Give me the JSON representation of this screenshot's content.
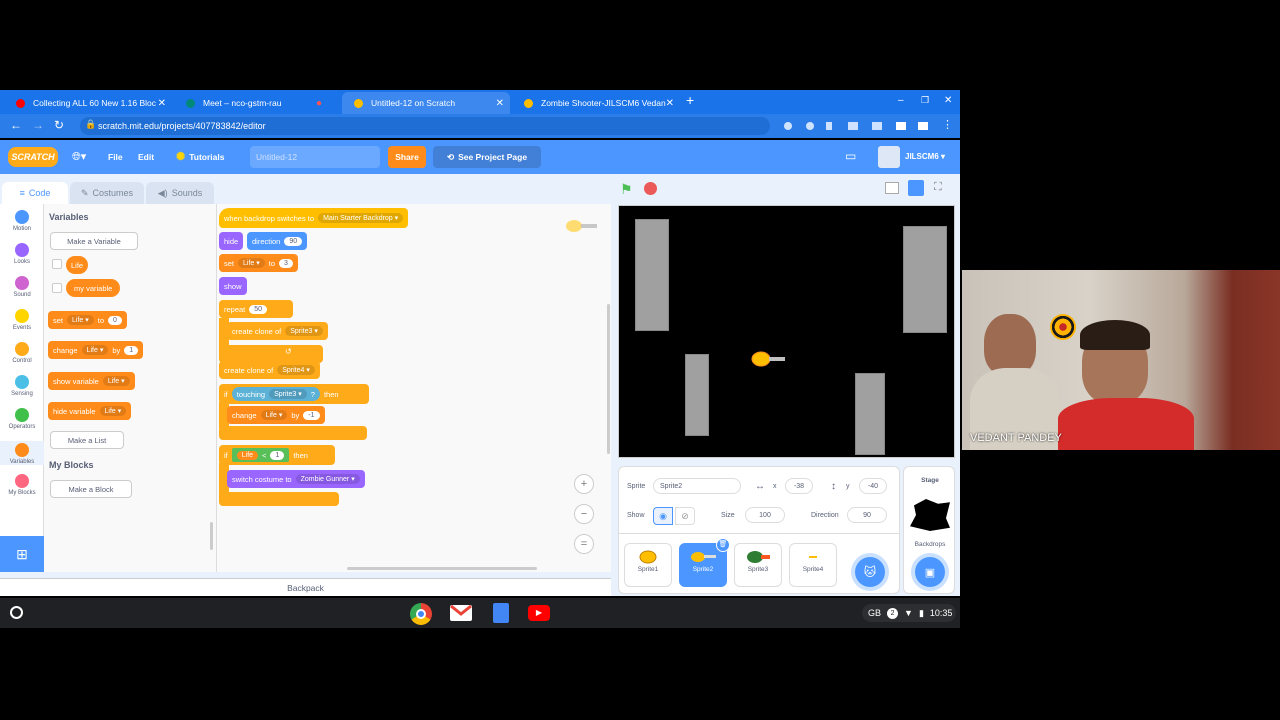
{
  "tabs": [
    {
      "title": "Collecting ALL 60 New 1.16 Bloc",
      "fav_color": "#ff0000"
    },
    {
      "title": "Meet – nco-gstm-rau",
      "fav_color": "#00897b"
    },
    {
      "title": "Untitled-12 on Scratch",
      "fav_color": "#ffbf00"
    },
    {
      "title": "Zombie Shooter-JILSCM6 Vedan",
      "fav_color": "#ffbf00"
    }
  ],
  "url": "scratch.mit.edu/projects/407783842/editor",
  "menu": {
    "logo": "SCRATCH",
    "file": "File",
    "edit": "Edit",
    "tutorials": "Tutorials",
    "project_title": "Untitled-12",
    "share": "Share",
    "see_project": "See Project Page",
    "username": "JILSCM6"
  },
  "editor_tabs": {
    "code": "Code",
    "costumes": "Costumes",
    "sounds": "Sounds"
  },
  "categories": [
    {
      "label": "Motion",
      "color": "#4c97ff"
    },
    {
      "label": "Looks",
      "color": "#9966ff"
    },
    {
      "label": "Sound",
      "color": "#cf63cf"
    },
    {
      "label": "Events",
      "color": "#ffd500"
    },
    {
      "label": "Control",
      "color": "#ffab19"
    },
    {
      "label": "Sensing",
      "color": "#4cbfe6"
    },
    {
      "label": "Operators",
      "color": "#40bf4a"
    },
    {
      "label": "Variables",
      "color": "#ff8c1a"
    },
    {
      "label": "My Blocks",
      "color": "#ff6680"
    }
  ],
  "palette": {
    "heading": "Variables",
    "make_variable": "Make a Variable",
    "var1": "Life",
    "var2": "my variable",
    "set": "set",
    "set_var": "Life",
    "to": "to",
    "set_val": "0",
    "change": "change",
    "change_var": "Life",
    "by": "by",
    "change_val": "1",
    "show_var": "show variable",
    "show_var_name": "Life",
    "hide_var": "hide variable",
    "hide_var_name": "Life",
    "make_list": "Make a List",
    "myblocks_heading": "My Blocks",
    "make_block": "Make a Block"
  },
  "script": {
    "hat": "when backdrop switches to",
    "hat_arg": "Main Starter Backdrop",
    "hide": "hide",
    "direction": "direction",
    "direction_val": "90",
    "set": "set",
    "set_var": "Life",
    "to": "to",
    "set_val": "3",
    "show": "show",
    "repeat": "repeat",
    "repeat_val": "50",
    "clone1": "create clone of",
    "clone1_arg": "Sprite3",
    "clone2": "create clone of",
    "clone2_arg": "Sprite4",
    "if1": "if",
    "touching": "touching",
    "touching_arg": "Sprite3",
    "q": "?",
    "then1": "then",
    "change": "change",
    "change_var": "Life",
    "by": "by",
    "change_val": "-1",
    "if2": "if",
    "lt_var": "Life",
    "lt": "<",
    "lt_val": "1",
    "then2": "then",
    "switch_costume": "switch costume to",
    "costume_arg": "Zombie Gunner"
  },
  "zoom": {
    "in": "+",
    "out": "−",
    "reset": "="
  },
  "backpack": "Backpack",
  "sprite_info": {
    "sprite_label": "Sprite",
    "sprite_name": "Sprite2",
    "x_label": "x",
    "x": "-38",
    "y_label": "y",
    "y": "-40",
    "show_label": "Show",
    "size_label": "Size",
    "size": "100",
    "direction_label": "Direction",
    "direction": "90"
  },
  "sprites": [
    "Sprite1",
    "Sprite2",
    "Sprite3",
    "Sprite4"
  ],
  "stage_panel": {
    "title": "Stage",
    "backdrops": "Backdrops"
  },
  "taskbar": {
    "locale": "GB",
    "badge": "2",
    "time": "10:35"
  },
  "webcam": {
    "name": "VEDANT PANDEY"
  }
}
